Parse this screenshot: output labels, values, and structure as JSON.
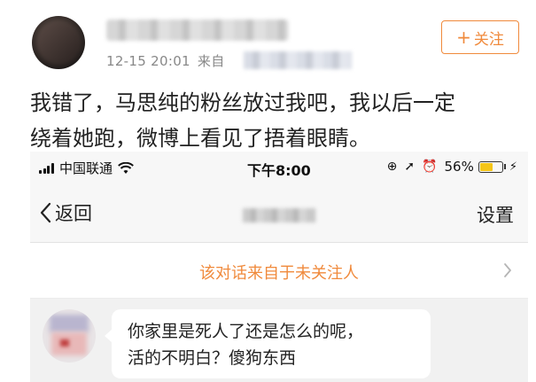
{
  "post": {
    "timestamp": "12-15 20:01",
    "source_prefix": "来自",
    "follow_label": "关注",
    "text_line1": "我错了，马思纯的粉丝放过我吧，我以后一定",
    "text_line2": "绕着她跑，微博上看见了捂着眼睛。"
  },
  "phone": {
    "status_bar": {
      "carrier": "中国联通",
      "time": "下午8:00",
      "battery_percent": "56%",
      "battery_level": 0.56,
      "icons": [
        "signal-icon",
        "wifi-icon",
        "lock-rotation-icon",
        "location-icon",
        "alarm-icon",
        "battery-icon",
        "charging-icon"
      ]
    },
    "nav": {
      "back_label": "返回",
      "settings_label": "设置"
    },
    "notice": "该对话来自于未关注人",
    "message": {
      "line1": "你家里是死人了还是怎么的呢，",
      "line2": "活的不明白？傻狗东西"
    }
  },
  "colors": {
    "accent": "#f08a3c",
    "battery_fill": "#f5c518"
  }
}
